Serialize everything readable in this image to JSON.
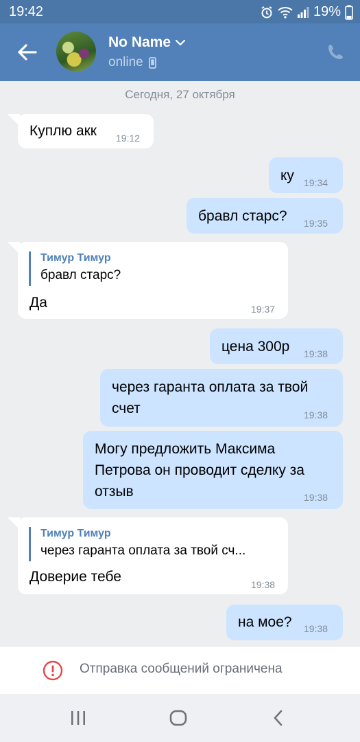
{
  "status": {
    "time": "19:42",
    "battery": "19%"
  },
  "header": {
    "name": "No Name",
    "presence": "online"
  },
  "date": "Сегодня, 27 октября",
  "messages": [
    {
      "dir": "in",
      "text": "Куплю акк",
      "time": "19:12"
    },
    {
      "dir": "out",
      "text": "ку",
      "time": "19:34"
    },
    {
      "dir": "out",
      "text": "бравл старс?",
      "time": "19:35"
    },
    {
      "dir": "in",
      "reply_author": "Тимур Тимур",
      "reply_text": "бравл старс?",
      "text": "Да",
      "time": "19:37"
    },
    {
      "dir": "out",
      "text": "цена 300р",
      "time": "19:38"
    },
    {
      "dir": "out",
      "line1": "через гаранта оплата за твой",
      "line2": "счет",
      "time": "19:38"
    },
    {
      "dir": "out",
      "line1": "Могу предложить Максима",
      "line2": "Петрова он проводит сделку за",
      "line3": "отзыв",
      "time": "19:38"
    },
    {
      "dir": "in",
      "reply_author": "Тимур Тимур",
      "reply_text": "через гаранта оплата за твой сч...",
      "text": "Доверие тебе",
      "time": "19:38"
    },
    {
      "dir": "out",
      "text": "на мое?",
      "time": "19:38"
    }
  ],
  "restricted_text": "Отправка сообщений ограничена",
  "icons": {
    "back": "arrow-left-icon",
    "call": "phone-icon",
    "mobile": "mobile-icon",
    "restricted": "exclamation-circle-icon",
    "alarm": "alarm-icon",
    "wifi": "wifi-icon",
    "signal": "signal-icon",
    "battery": "battery-icon"
  },
  "colors": {
    "header": "#5181b8",
    "status_bar": "#4a76a8",
    "incoming": "#ffffff",
    "outgoing": "#cce4ff",
    "accent": "#5181b8",
    "warning": "#e64646"
  }
}
